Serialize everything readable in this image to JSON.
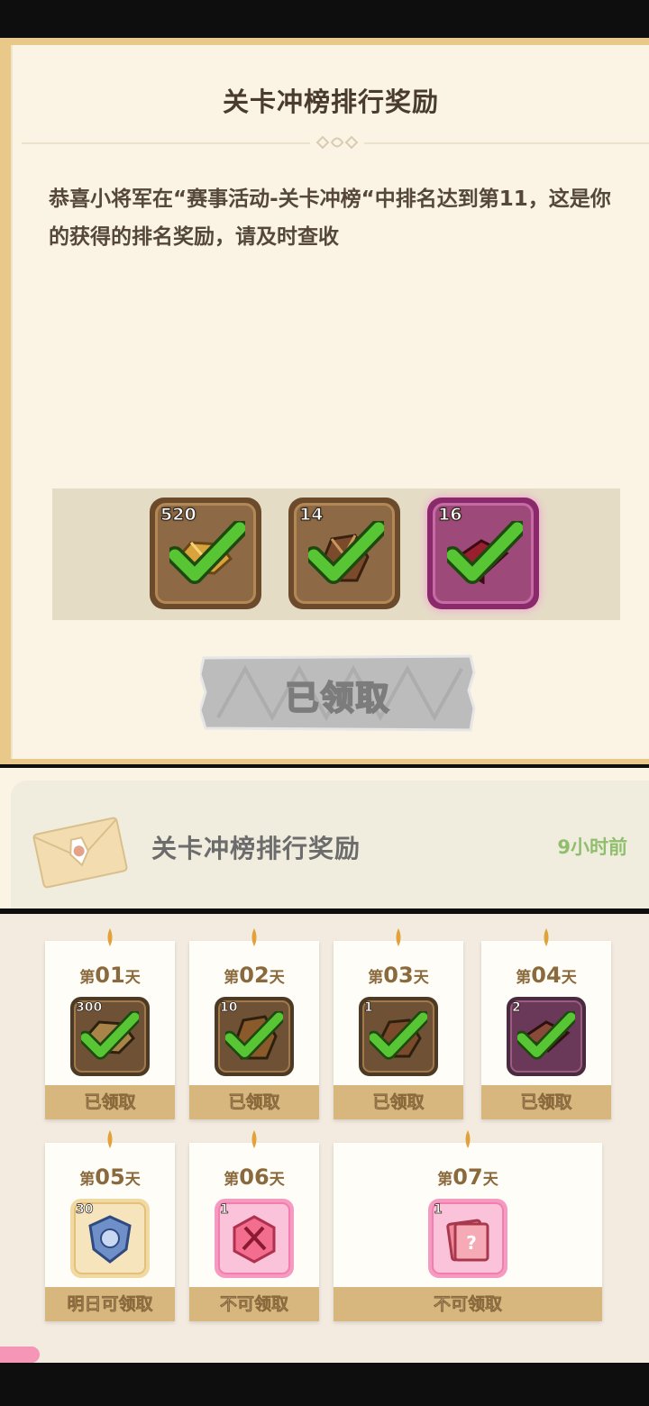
{
  "detail": {
    "title": "关卡冲榜排行奖励",
    "body": "恭喜小将军在“赛事活动-关卡冲榜“中排名达到第11，这是你的获得的排名奖励，请及时查收",
    "rewards": [
      {
        "qty": "520",
        "claimed": true,
        "rarity": "brown"
      },
      {
        "qty": "14",
        "claimed": true,
        "rarity": "brown"
      },
      {
        "qty": "16",
        "claimed": true,
        "rarity": "purple"
      }
    ],
    "claim_button": "已领取"
  },
  "mail_list": {
    "title": "关卡冲榜排行奖励",
    "time": "9小时前",
    "icon": "envelope-icon"
  },
  "daily": {
    "day_prefix": "第",
    "day_suffix": "天",
    "cards": [
      {
        "day": "01",
        "qty": "300",
        "status": "已领取",
        "claimed": true
      },
      {
        "day": "02",
        "qty": "10",
        "status": "已领取",
        "claimed": true
      },
      {
        "day": "03",
        "qty": "1",
        "status": "已领取",
        "claimed": true
      },
      {
        "day": "04",
        "qty": "2",
        "status": "已领取",
        "claimed": true
      },
      {
        "day": "05",
        "qty": "30",
        "status": "明日可领取",
        "claimed": false
      },
      {
        "day": "06",
        "qty": "1",
        "status": "不可领取",
        "claimed": false
      },
      {
        "day": "07",
        "qty": "1",
        "status": "不可领取",
        "claimed": false
      }
    ]
  },
  "colors": {
    "paper": "#fbf4e4",
    "gold_bar": "#d8b77f",
    "check_green": "#58c534",
    "time_green": "#8fbf6d",
    "title_brown": "#4a3c2c"
  }
}
